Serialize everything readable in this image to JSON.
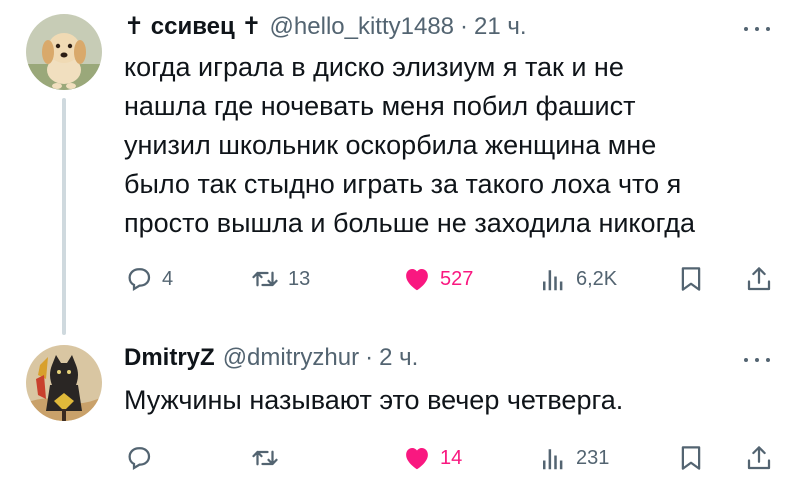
{
  "tweets": [
    {
      "author": {
        "display_name": "✝ ссивец ✝",
        "handle": "@hello_kitty1488",
        "avatar_icon": "puppy-avatar"
      },
      "separator": "·",
      "time": "21 ч.",
      "text": "когда играла в диско элизиум я так и не\nнашла где ночевать меня побил фашист\nунизил школьник оскорбила женщина мне\nбыло так стыдно играть за такого лоха что я\nпросто вышла и больше не заходила никогда",
      "stats": {
        "replies": "4",
        "retweets": "13",
        "likes": "527",
        "views": "6,2K"
      },
      "liked": true
    },
    {
      "author": {
        "display_name": "DmitryZ",
        "handle": "@dmitryzhur",
        "avatar_icon": "cat-painting-avatar"
      },
      "separator": "·",
      "time": "2 ч.",
      "text": "Мужчины называют это вечер четверга.",
      "stats": {
        "replies": "",
        "retweets": "",
        "likes": "14",
        "views": "231"
      },
      "liked": true
    }
  ],
  "colors": {
    "text": "#0f1419",
    "secondary": "#536471",
    "like": "#f91880",
    "thread_line": "#cfd9de"
  }
}
